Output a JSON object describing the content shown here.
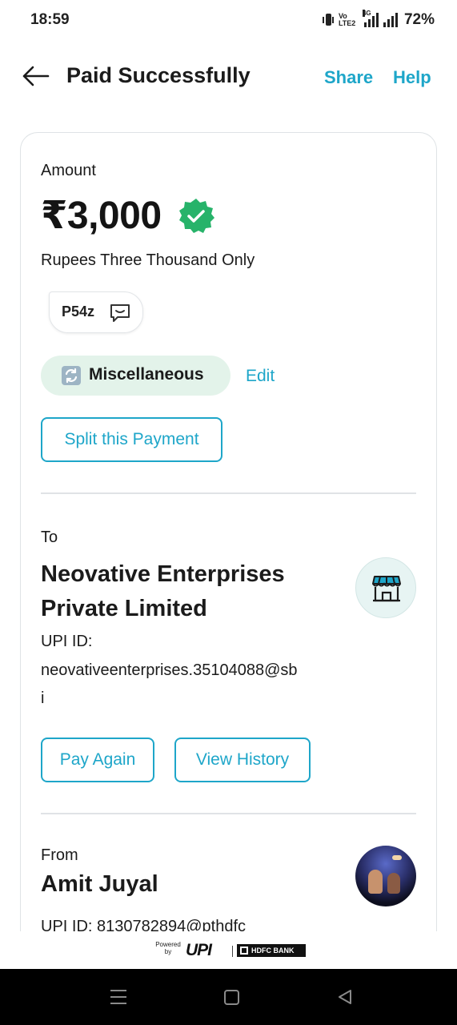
{
  "status_bar": {
    "time": "18:59",
    "volte_line1": "Vo",
    "volte_line2": "LTE2",
    "network_type": "4G",
    "battery": "72%"
  },
  "header": {
    "title": "Paid Successfully",
    "share_label": "Share",
    "help_label": "Help"
  },
  "amount_section": {
    "label": "Amount",
    "value": "₹3,000",
    "in_words": "Rupees Three Thousand Only",
    "note": "P54z",
    "category": "Miscellaneous",
    "edit_label": "Edit",
    "split_button": "Split this Payment"
  },
  "to_section": {
    "label": "To",
    "name_line1": "Neovative Enterprises",
    "name_line2": "Private Limited",
    "upi_label": "UPI ID:",
    "upi_line1": "neovativeenterprises.35104088@sb",
    "upi_line2": "i",
    "pay_again_button": "Pay Again",
    "view_history_button": "View History"
  },
  "from_section": {
    "label": "From",
    "name": "Amit Juyal",
    "upi_partial": "UPI ID: 8130782894@pthdfc"
  },
  "footer": {
    "powered_line1": "Powered",
    "powered_line2": "by",
    "upi_logo_text": "UPI",
    "bank_logo_text": "HDFC BANK"
  },
  "colors": {
    "accent": "#1ea6c9",
    "verified_green": "#27b36a",
    "category_bg": "#e3f3ea"
  }
}
